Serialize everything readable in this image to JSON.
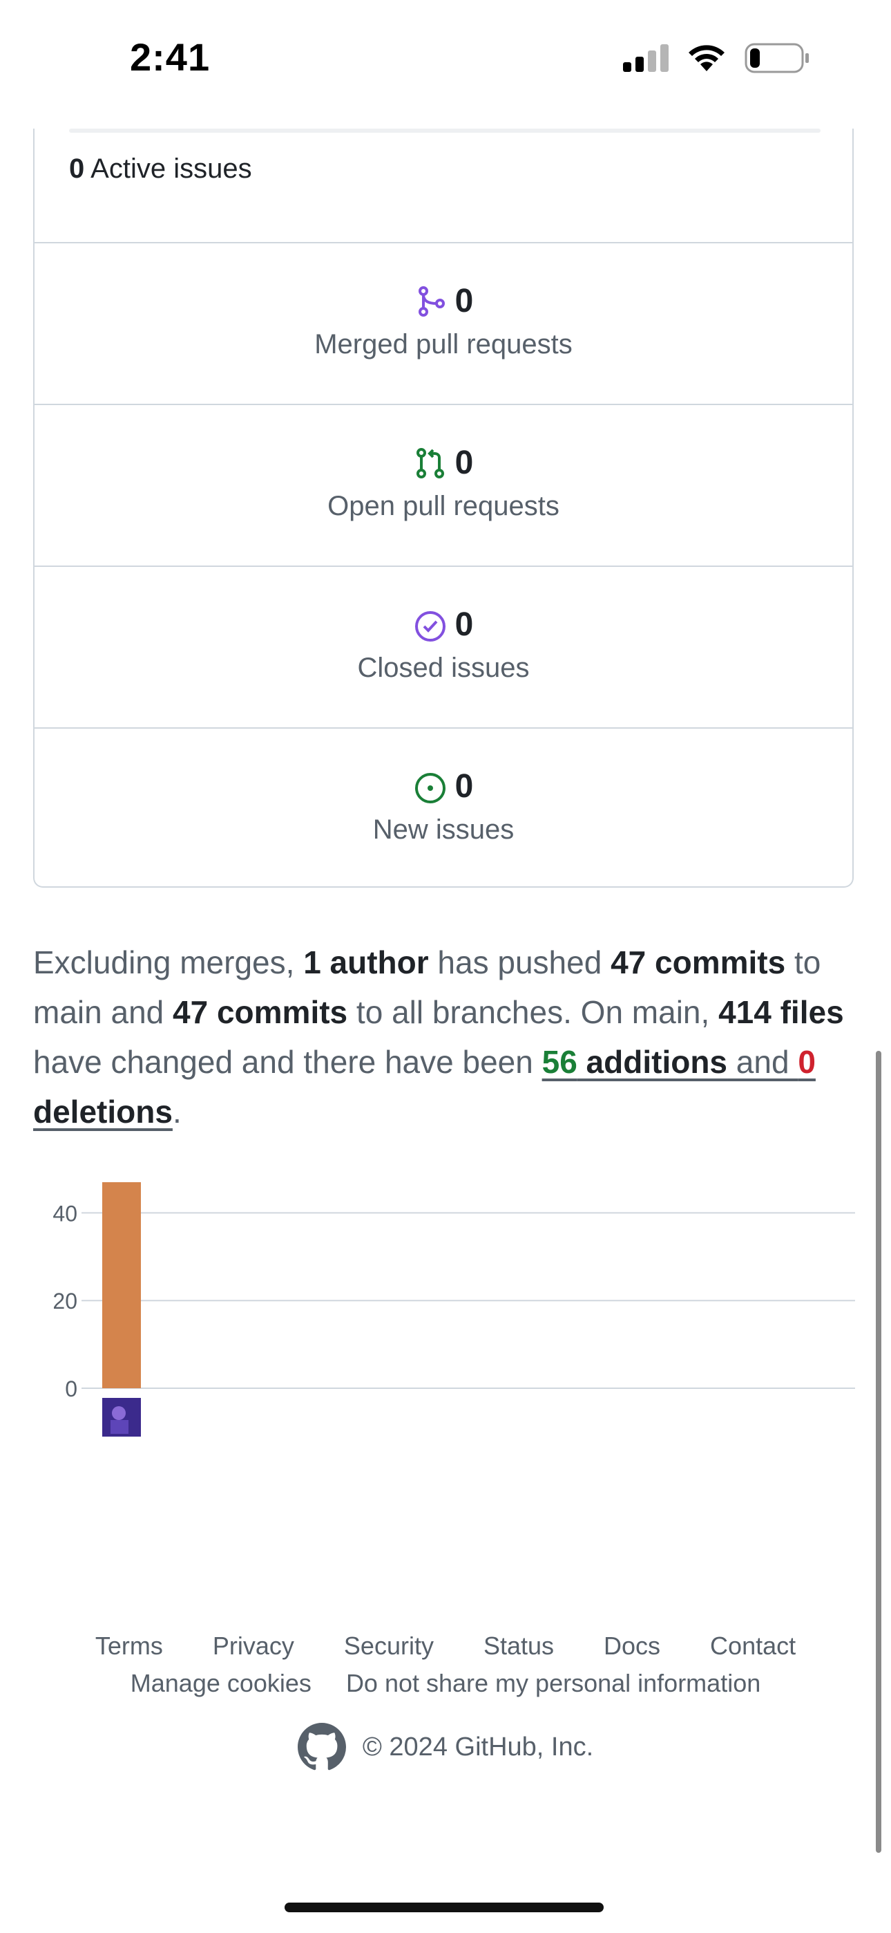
{
  "status_bar": {
    "time": "2:41",
    "battery_level": 0.2
  },
  "stats": {
    "active_issues": {
      "count": "0",
      "label": "Active issues"
    },
    "rows": [
      {
        "count": "0",
        "label": "Merged pull requests",
        "icon": "git-merge-icon",
        "color": "#8250df"
      },
      {
        "count": "0",
        "label": "Open pull requests",
        "icon": "git-pull-request-icon",
        "color": "#1a7f37"
      },
      {
        "count": "0",
        "label": "Closed issues",
        "icon": "issue-closed-icon",
        "color": "#8250df"
      },
      {
        "count": "0",
        "label": "New issues",
        "icon": "issue-opened-icon",
        "color": "#1a7f37"
      }
    ]
  },
  "summary": {
    "t1": "Excluding merges, ",
    "authors": "1 author",
    "t2": " has pushed ",
    "commits_main": "47 commits",
    "t3": " to main and ",
    "commits_all": "47 commits",
    "t4": " to all branches. On main, ",
    "files": "414 files",
    "t5": " have changed and there have been ",
    "additions_num": "56",
    "additions_label": " additions",
    "t6": " and ",
    "deletions_num": "0",
    "deletions_label": " deletions",
    "t7": "."
  },
  "chart_data": {
    "type": "bar",
    "categories": [
      "author-1"
    ],
    "values": [
      47
    ],
    "ylim": [
      0,
      47
    ],
    "yticks": [
      "0",
      "20",
      "40"
    ],
    "bar_color": "#d4844c",
    "grid": true
  },
  "footer": {
    "links": [
      "Terms",
      "Privacy",
      "Security",
      "Status",
      "Docs",
      "Contact"
    ],
    "links2": [
      "Manage cookies",
      "Do not share my personal information"
    ],
    "copyright": "© 2024 GitHub, Inc."
  }
}
